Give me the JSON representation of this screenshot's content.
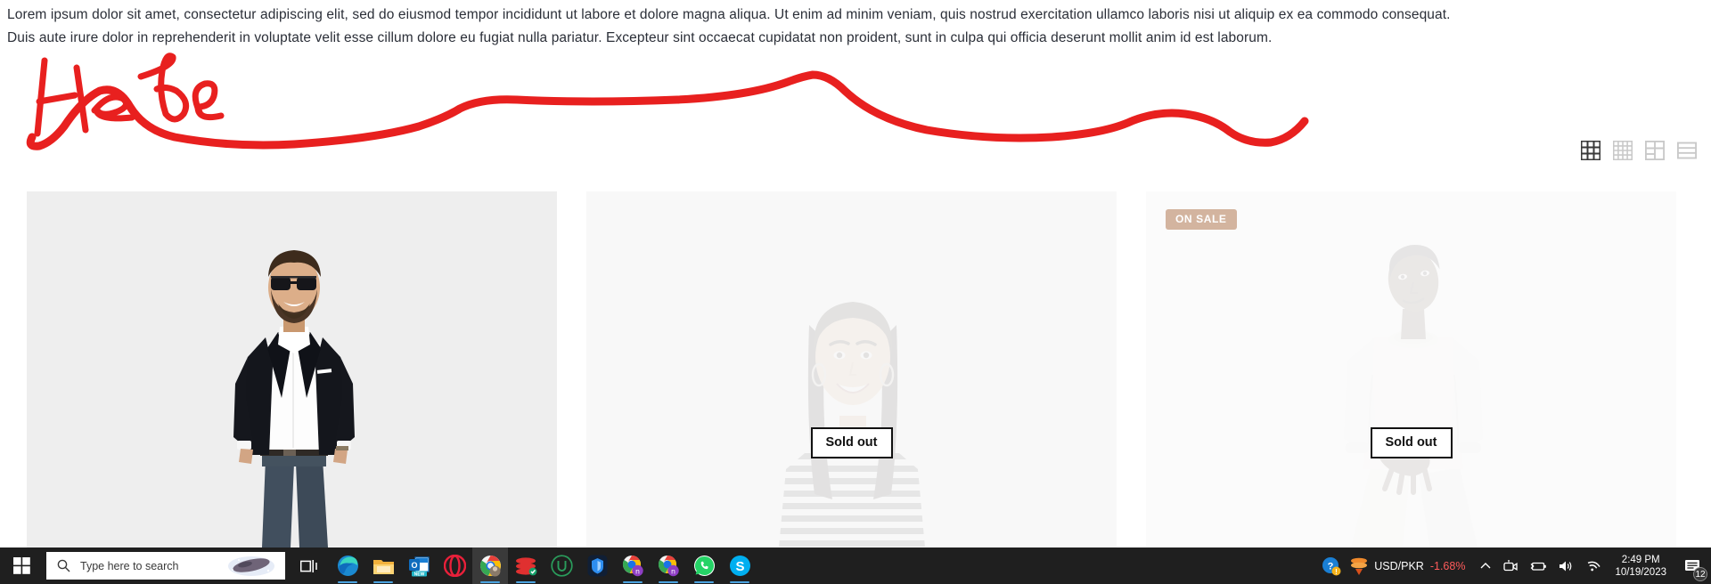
{
  "page": {
    "intro_line_1": "Lorem ipsum dolor sit amet, consectetur adipiscing elit, sed do eiusmod tempor incididunt ut labore et dolore magna aliqua. Ut enim ad minim veniam, quis nostrud exercitation ullamco laboris nisi ut aliquip ex ea commodo consequat.",
    "intro_line_2": "Duis aute irure dolor in reprehenderit in voluptate velit esse cillum dolore eu fugiat nulla pariatur. Excepteur sint occaecat cupidatat non proident, sunt in culpa qui officia deserunt mollit anim id est laborum."
  },
  "annotation": {
    "handwritten_text": "Here",
    "color": "#e8201f",
    "type": "red-marker-underline"
  },
  "layout_switcher": {
    "options": [
      {
        "name": "grid-3-columns",
        "selected": true,
        "color": "#3a3a3a"
      },
      {
        "name": "grid-4-columns",
        "selected": false,
        "color": "#cccccc"
      },
      {
        "name": "grid-mixed",
        "selected": false,
        "color": "#cccccc"
      },
      {
        "name": "list-view",
        "selected": false,
        "color": "#cccccc"
      }
    ]
  },
  "products": [
    {
      "name": "product-card-1",
      "figure": "man-black-blazer-sunglasses",
      "background": "#eeeeee",
      "badge": null,
      "sold_out_label": null,
      "faded": false
    },
    {
      "name": "product-card-2",
      "figure": "woman-striped-shirt",
      "background": "#f8f8f8",
      "badge": null,
      "sold_out_label": "Sold out",
      "faded": true
    },
    {
      "name": "product-card-3",
      "figure": "man-white-sweatshirt-seated",
      "background": "#fbfbfb",
      "badge": "ON SALE",
      "badge_color": "#d3b49f",
      "sold_out_label": "Sold out",
      "faded": true
    }
  ],
  "taskbar": {
    "start_label": "Start",
    "search": {
      "placeholder": "Type here to search",
      "icon": "search-icon"
    },
    "task_view_label": "Task View",
    "apps": [
      {
        "name": "microsoft-edge",
        "label": "Microsoft Edge",
        "running": true,
        "active": false
      },
      {
        "name": "file-explorer",
        "label": "File Explorer",
        "running": true,
        "active": false
      },
      {
        "name": "outlook-new",
        "label": "Outlook (NEW)",
        "running": false,
        "active": false
      },
      {
        "name": "opera",
        "label": "Opera",
        "running": false,
        "active": false
      },
      {
        "name": "google-chrome",
        "label": "Google Chrome",
        "running": true,
        "active": true
      },
      {
        "name": "red-stack-app",
        "label": "Adobe Reader",
        "running": true,
        "active": false
      },
      {
        "name": "utorrent",
        "label": "uTorrent",
        "running": false,
        "active": false
      },
      {
        "name": "vpn-shield",
        "label": "VPN",
        "running": false,
        "active": false
      },
      {
        "name": "chrome-profile-n1",
        "label": "Chrome Profile",
        "running": true,
        "active": false
      },
      {
        "name": "chrome-profile-n2",
        "label": "Chrome Profile",
        "running": true,
        "active": false
      },
      {
        "name": "whatsapp",
        "label": "WhatsApp",
        "running": true,
        "active": false
      },
      {
        "name": "skype",
        "label": "Skype",
        "running": true,
        "active": false
      }
    ],
    "tray": {
      "help_icon": "help-warning-icon",
      "stocks": {
        "pair": "USD/PKR",
        "change": "-1.68%",
        "change_color": "#ff5b5b"
      },
      "show_hidden_icons": "chevron-up-icon",
      "icons": [
        {
          "name": "camera-icon"
        },
        {
          "name": "battery-icon"
        },
        {
          "name": "volume-icon"
        },
        {
          "name": "wifi-icon"
        }
      ],
      "clock": {
        "time": "2:49 PM",
        "date": "10/19/2023"
      },
      "notifications": {
        "icon": "notification-icon",
        "count": "12"
      }
    }
  }
}
